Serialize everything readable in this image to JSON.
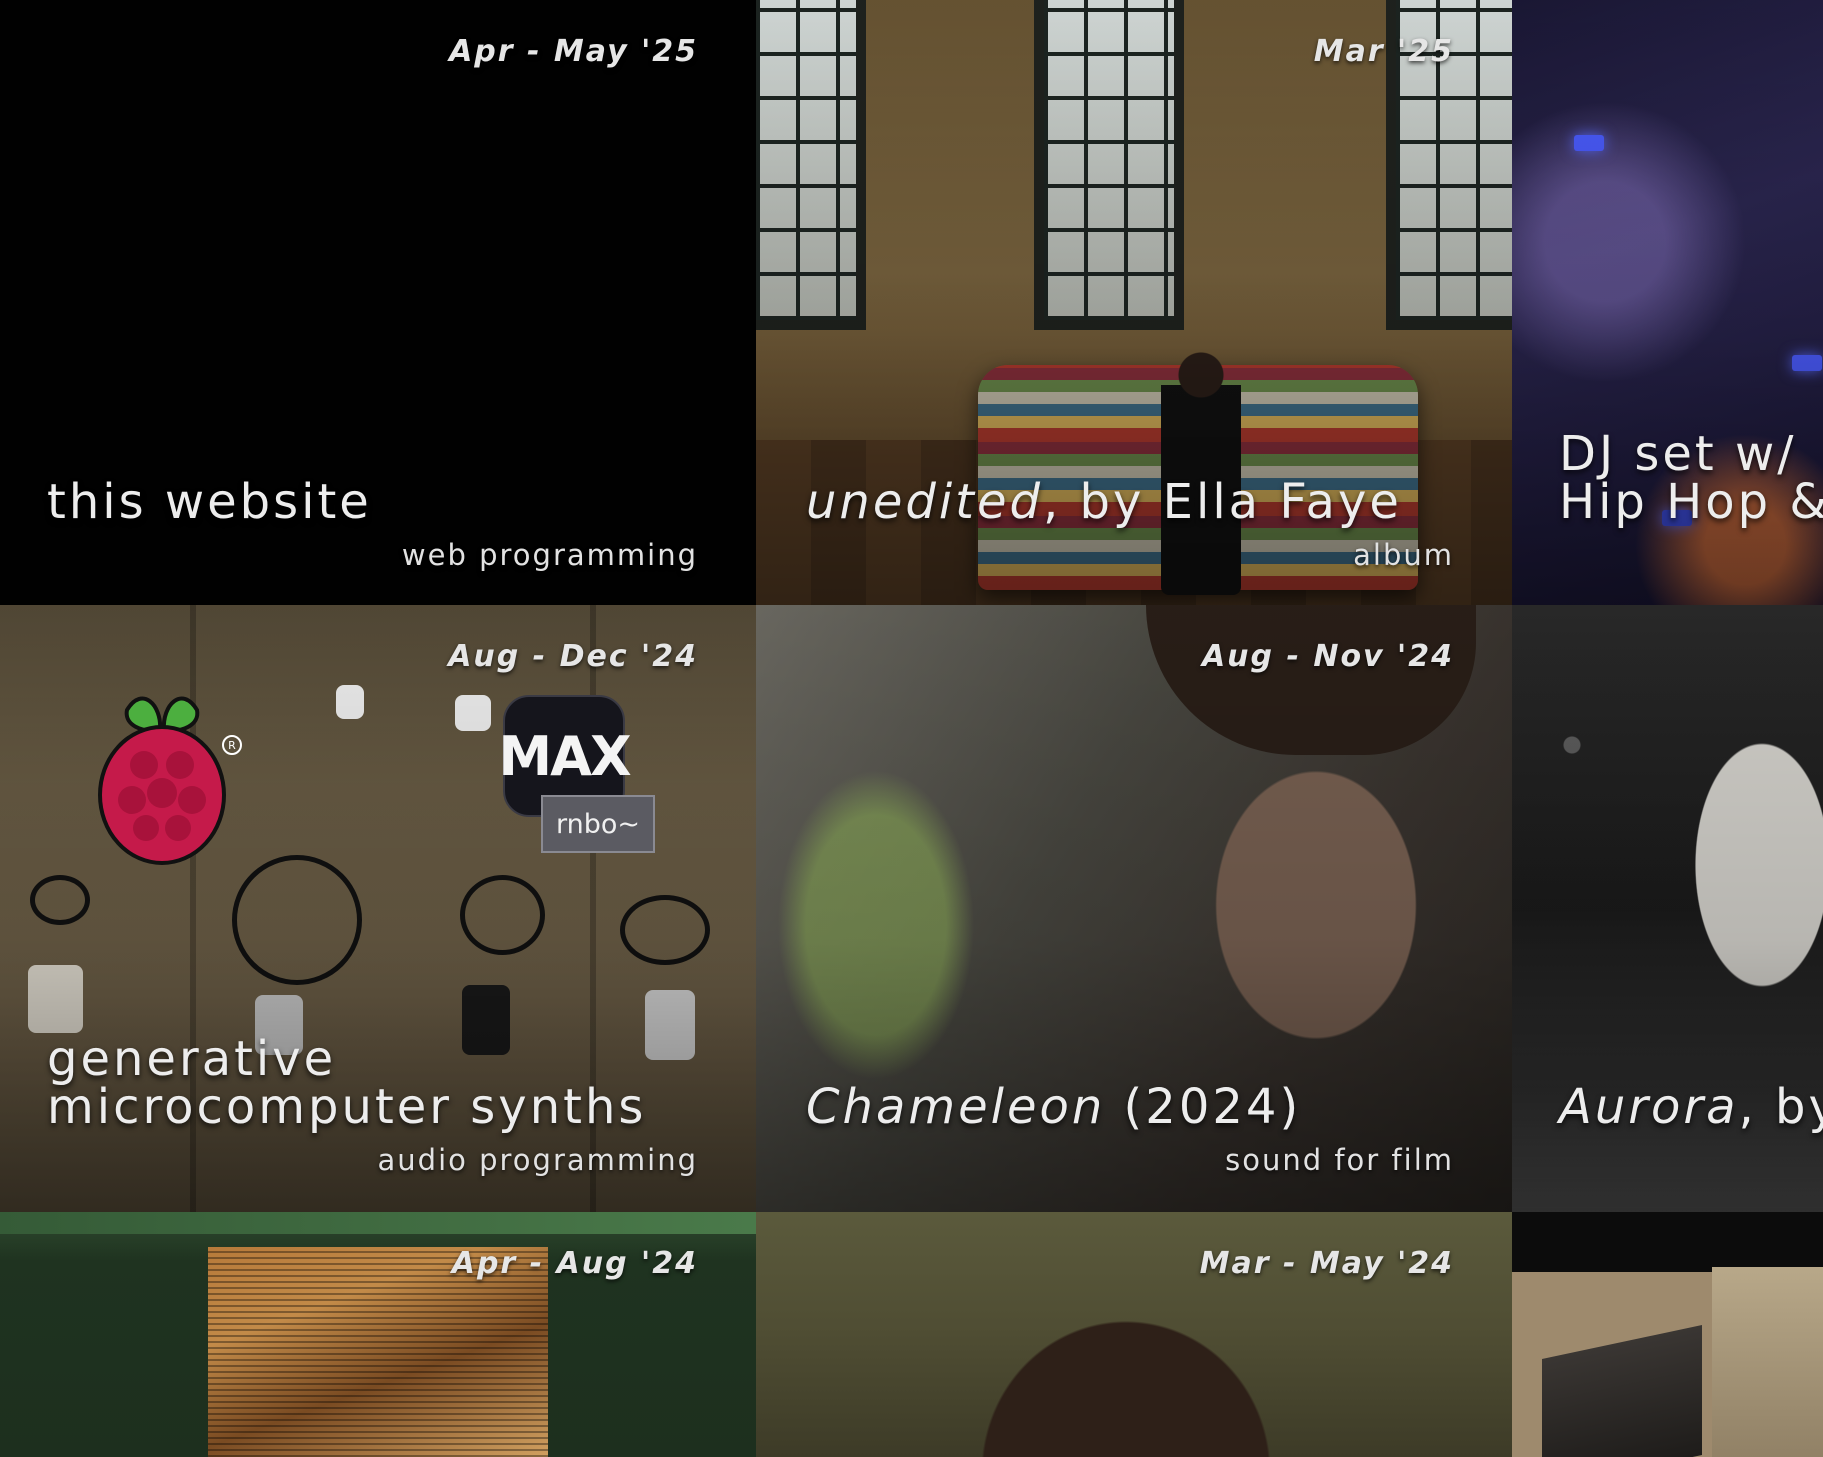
{
  "projects": [
    {
      "date": "Apr - May '25",
      "title": "this website",
      "subtitle": "web programming"
    },
    {
      "date": "Mar '25",
      "title_italic": "unedited",
      "title_rest": ", by Ella Faye",
      "subtitle": "album"
    },
    {
      "title_line1": "DJ set w/",
      "title_line2": "Hip Hop &"
    },
    {
      "date": "Aug - Dec '24",
      "title_line1": "generative",
      "title_line2": "microcomputer synths",
      "subtitle": "audio programming",
      "logo_text": "MAX",
      "badge": "rnbo~"
    },
    {
      "date": "Aug - Nov '24",
      "title_italic": "Chameleon",
      "title_rest": " (2024)",
      "subtitle": "sound for film"
    },
    {
      "title_italic": "Aurora",
      "title_rest": ", by"
    },
    {
      "date": "Apr - Aug '24"
    },
    {
      "date": "Mar - May '24"
    },
    {}
  ],
  "colors": {
    "text": "#ededed",
    "rpi_red": "#c51a4a",
    "rpi_green": "#4caf3f"
  }
}
